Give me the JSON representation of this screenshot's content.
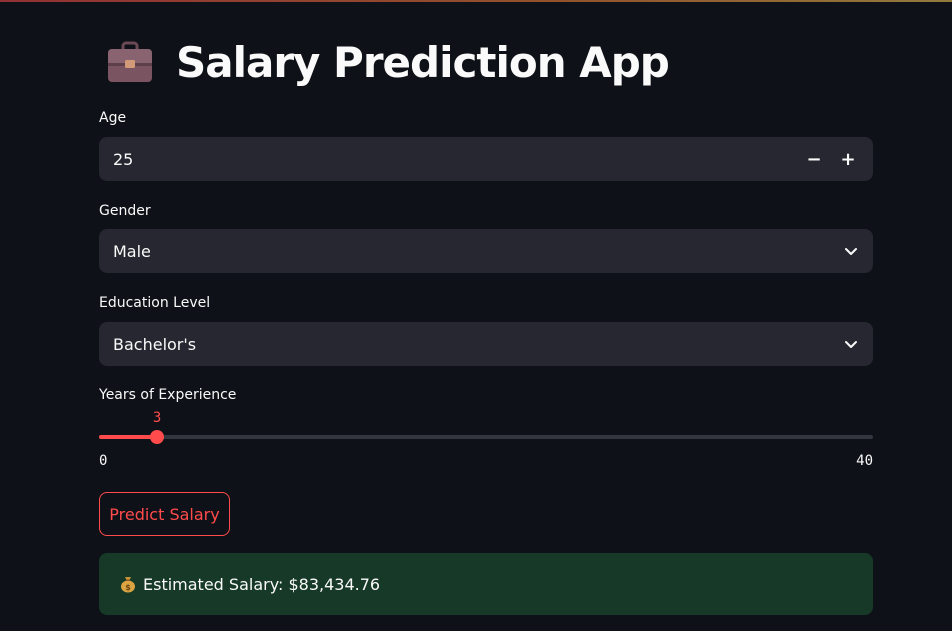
{
  "app": {
    "title": "Salary Prediction App",
    "icon": "briefcase-icon",
    "accent_color": "#ff4b4b",
    "background": "#0e1117"
  },
  "form": {
    "age": {
      "label": "Age",
      "value": "25",
      "decrement_label": "−",
      "increment_label": "+"
    },
    "gender": {
      "label": "Gender",
      "selected": "Male"
    },
    "education": {
      "label": "Education Level",
      "selected": "Bachelor's"
    },
    "experience": {
      "label": "Years of Experience",
      "value": 3,
      "value_text": "3",
      "min": 0,
      "max": 40,
      "min_text": "0",
      "max_text": "40"
    }
  },
  "actions": {
    "predict_label": "Predict Salary"
  },
  "result": {
    "icon": "money-bag-icon",
    "text": "Estimated Salary: $83,434.76",
    "color": "#173928"
  }
}
